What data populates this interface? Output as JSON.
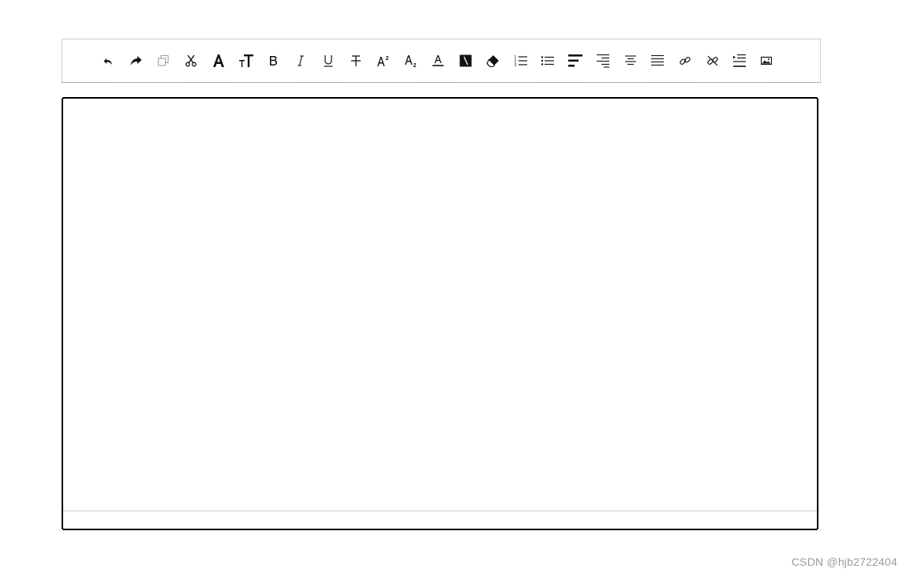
{
  "toolbar": {
    "tools": [
      {
        "icon": "undo-icon"
      },
      {
        "icon": "redo-icon"
      },
      {
        "icon": "copy-icon"
      },
      {
        "icon": "cut-icon"
      },
      {
        "icon": "font-size-icon"
      },
      {
        "icon": "line-height-icon"
      },
      {
        "icon": "bold-icon"
      },
      {
        "icon": "italic-icon"
      },
      {
        "icon": "underline-icon"
      },
      {
        "icon": "strikethrough-icon"
      },
      {
        "icon": "superscript-icon"
      },
      {
        "icon": "subscript-icon"
      },
      {
        "icon": "font-color-icon"
      },
      {
        "icon": "background-color-icon"
      },
      {
        "icon": "clear-format-icon"
      },
      {
        "icon": "ordered-list-icon"
      },
      {
        "icon": "unordered-list-icon"
      },
      {
        "icon": "align-left-icon"
      },
      {
        "icon": "align-right-icon"
      },
      {
        "icon": "align-center-icon"
      },
      {
        "icon": "align-justify-icon"
      },
      {
        "icon": "link-icon"
      },
      {
        "icon": "unlink-icon"
      },
      {
        "icon": "indent-icon"
      },
      {
        "icon": "image-icon"
      }
    ]
  },
  "editor": {
    "content": ""
  },
  "watermark": "CSDN @hjb2722404"
}
